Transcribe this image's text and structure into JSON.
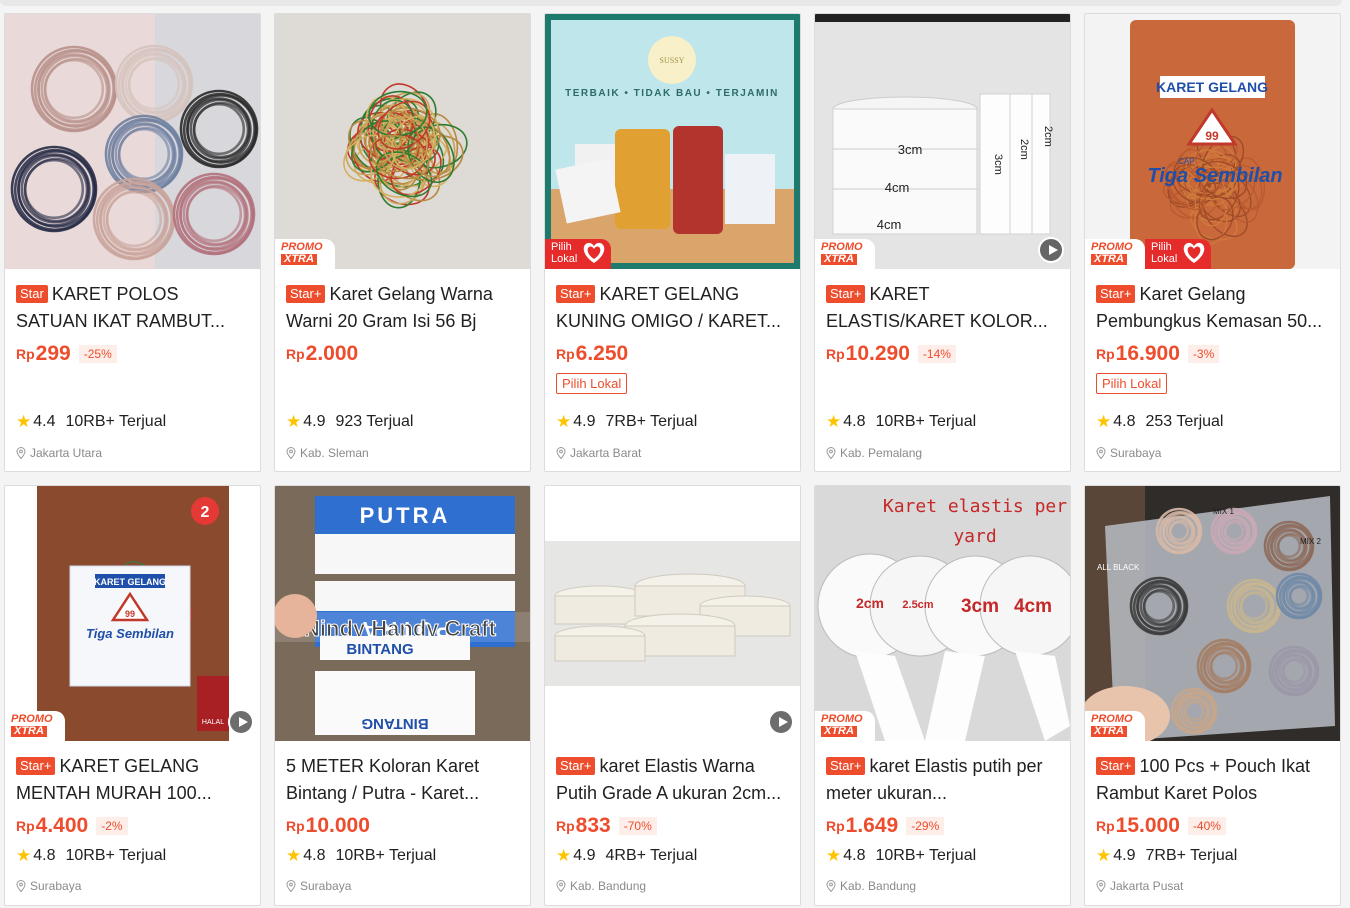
{
  "products": [
    {
      "title": "KARET POLOS SATUAN IKAT RAMBUT...",
      "tag": "Star",
      "price_prefix": "Rp",
      "price": "299",
      "discount": "-25%",
      "lokal": "",
      "rating": "4.4",
      "sold": "10RB+ Terjual",
      "location": "Jakarta Utara",
      "badges": []
    },
    {
      "title": "Karet Gelang Warna Warni 20 Gram Isi 56 Bj",
      "tag": "Star+",
      "price_prefix": "Rp",
      "price": "2.000",
      "discount": "",
      "lokal": "",
      "rating": "4.9",
      "sold": "923 Terjual",
      "location": "Kab. Sleman",
      "badges": [
        "promo"
      ]
    },
    {
      "title": "KARET GELANG KUNING OMIGO / KARET...",
      "tag": "Star+",
      "price_prefix": "Rp",
      "price": "6.250",
      "discount": "",
      "lokal": "Pilih Lokal",
      "rating": "4.9",
      "sold": "7RB+ Terjual",
      "location": "Jakarta Barat",
      "badges": [
        "lokal"
      ]
    },
    {
      "title": "KARET ELASTIS/KARET KOLOR...",
      "tag": "Star+",
      "price_prefix": "Rp",
      "price": "10.290",
      "discount": "-14%",
      "lokal": "",
      "rating": "4.8",
      "sold": "10RB+ Terjual",
      "location": "Kab. Pemalang",
      "badges": [
        "promo",
        "play"
      ]
    },
    {
      "title": "Karet Gelang Pembungkus Kemasan 50...",
      "tag": "Star+",
      "price_prefix": "Rp",
      "price": "16.900",
      "discount": "-3%",
      "lokal": "Pilih Lokal",
      "rating": "4.8",
      "sold": "253 Terjual",
      "location": "Surabaya",
      "badges": [
        "promo",
        "lokal"
      ]
    },
    {
      "title": "KARET GELANG MENTAH MURAH 100...",
      "tag": "Star+",
      "price_prefix": "Rp",
      "price": "4.400",
      "discount": "-2%",
      "lokal": "",
      "rating": "4.8",
      "sold": "10RB+ Terjual",
      "location": "Surabaya",
      "badges": [
        "promo",
        "play"
      ]
    },
    {
      "title": "5 METER Koloran Karet Bintang / Putra - Karet...",
      "tag": "",
      "price_prefix": "Rp",
      "price": "10.000",
      "discount": "",
      "lokal": "",
      "rating": "4.8",
      "sold": "10RB+ Terjual",
      "location": "Surabaya",
      "badges": []
    },
    {
      "title": "karet Elastis Warna Putih Grade A ukuran 2cm...",
      "tag": "Star+",
      "price_prefix": "Rp",
      "price": "833",
      "discount": "-70%",
      "lokal": "",
      "rating": "4.9",
      "sold": "4RB+ Terjual",
      "location": "Kab. Bandung",
      "badges": [
        "play"
      ]
    },
    {
      "title": "karet Elastis putih per meter ukuran...",
      "tag": "Star+",
      "price_prefix": "Rp",
      "price": "1.649",
      "discount": "-29%",
      "lokal": "",
      "rating": "4.8",
      "sold": "10RB+ Terjual",
      "location": "Kab. Bandung",
      "badges": [
        "promo"
      ]
    },
    {
      "title": "100 Pcs + Pouch Ikat Rambut Karet Polos",
      "tag": "Star+",
      "price_prefix": "Rp",
      "price": "15.000",
      "discount": "-40%",
      "lokal": "",
      "rating": "4.9",
      "sold": "7RB+ Terjual",
      "location": "Jakarta Pusat",
      "badges": [
        "promo"
      ]
    }
  ],
  "image_text": {
    "p3_tagline": "TERBAIK • TIDAK BAU • TERJAMIN",
    "p3_logo": "SUSSY",
    "p4_sizes": [
      "3cm",
      "4cm",
      "4cm",
      "3cm",
      "2cm",
      "2cm"
    ],
    "p5_label": "KARET GELANG",
    "p5_brand": "Tiga Sembilan",
    "p5_caf": "CAP",
    "p5_number": "99",
    "p6_label": "KARET GELANG",
    "p6_brand": "Tiga Sembilan",
    "p6_halal": "HALAL",
    "p6_number": "99",
    "p6_corner": "2",
    "p7_putra": "PUTRA",
    "p7_bintang": "BINTANG",
    "p7_watermark": "Nindy Handy Craft",
    "p9_heading_1": "Karet elastis per",
    "p9_heading_2": "yard",
    "p9_sizes": [
      "2cm",
      "2.5cm",
      "3cm",
      "4cm"
    ],
    "p10_mix1": "MIX 1",
    "p10_mix2": "MIX 2",
    "p10_allblack": "ALL BLACK"
  },
  "badge_text": {
    "promo": "PROMO",
    "xtra": "XTRA",
    "pilih": "Pilih",
    "lokal": "Lokal"
  },
  "colors": {
    "accent": "#ee4d2d",
    "star": "#ffc400",
    "lokal_badge": "#e62b2b"
  }
}
